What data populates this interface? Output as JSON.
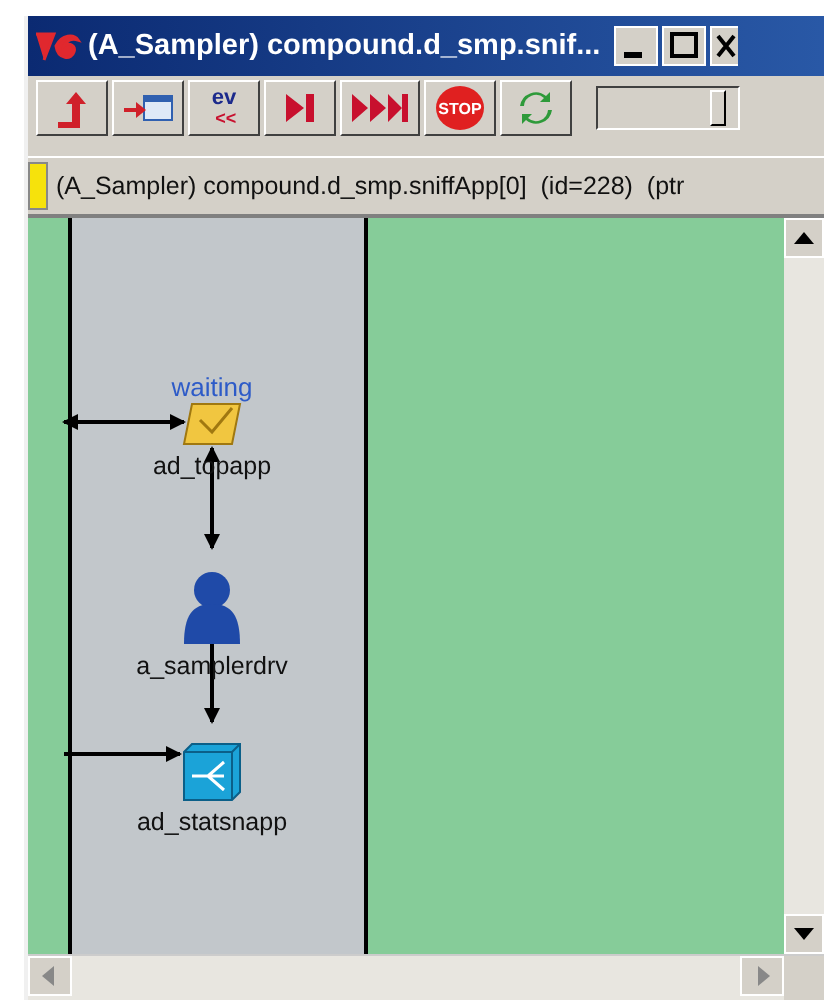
{
  "window": {
    "title": "(A_Sampler) compound.d_smp.snif..."
  },
  "toolbar": {
    "buttons": [
      {
        "kind": "up-arrow"
      },
      {
        "kind": "send"
      },
      {
        "kind": "event",
        "text": "ev",
        "subtext": "<<"
      },
      {
        "kind": "step"
      },
      {
        "kind": "run"
      },
      {
        "kind": "stop",
        "text": "STOP"
      },
      {
        "kind": "refresh"
      }
    ],
    "slider": {
      "level": 0.85
    }
  },
  "info_bar": {
    "text": "(A_Sampler) compound.d_smp.sniffApp[0]  (id=228)  (ptr"
  },
  "diagram": {
    "nodes": [
      {
        "kind": "mailbox",
        "label": "ad_topapp",
        "status": "waiting"
      },
      {
        "kind": "actor",
        "label": "a_samplerdrv"
      },
      {
        "kind": "router",
        "label": "ad_statsnapp"
      }
    ]
  }
}
